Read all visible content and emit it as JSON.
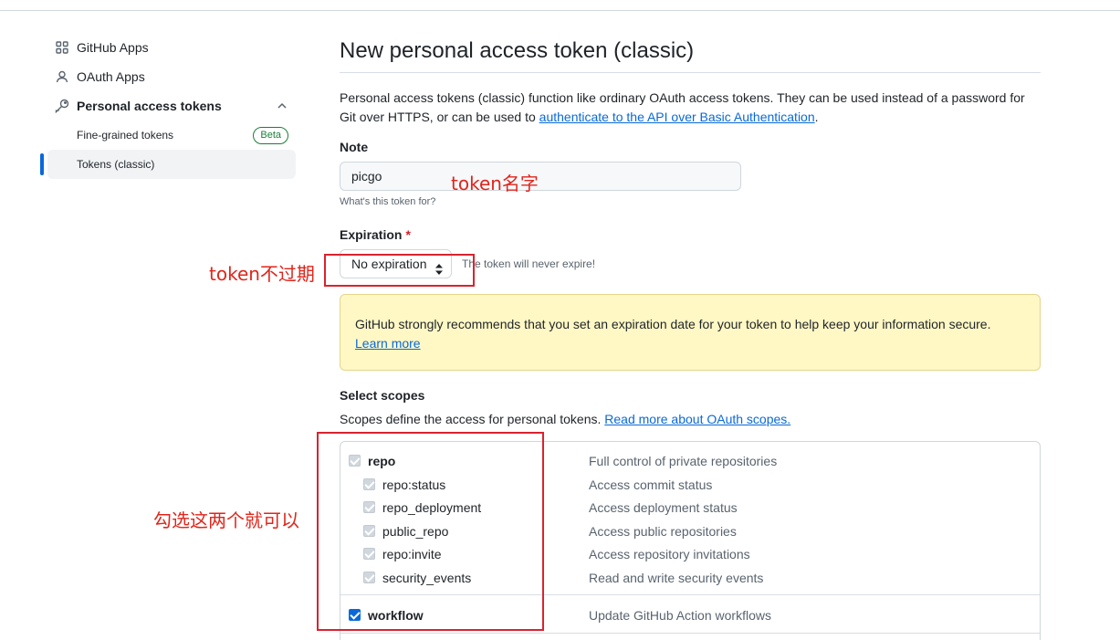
{
  "sidebar": {
    "items": [
      {
        "label": "GitHub Apps",
        "icon": "apps-grid-icon"
      },
      {
        "label": "OAuth Apps",
        "icon": "person-icon"
      },
      {
        "label": "Personal access tokens",
        "icon": "key-icon"
      }
    ],
    "sub_items": [
      {
        "label": "Fine-grained tokens",
        "badge": "Beta"
      },
      {
        "label": "Tokens (classic)",
        "active": true
      }
    ]
  },
  "main": {
    "title": "New personal access token (classic)",
    "description_prefix": "Personal access tokens (classic) function like ordinary OAuth access tokens. They can be used instead of a password for Git over HTTPS, or can be used to ",
    "description_link": "authenticate to the API over Basic Authentication",
    "description_suffix": ".",
    "note": {
      "label": "Note",
      "value": "picgo",
      "hint": "What's this token for?"
    },
    "expiration": {
      "label": "Expiration",
      "required_mark": "*",
      "selected": "No expiration",
      "note": "The token will never expire!"
    },
    "flash": {
      "text": "GitHub strongly recommends that you set an expiration date for your token to help keep your information secure.",
      "link": "Learn more"
    },
    "scopes": {
      "label": "Select scopes",
      "desc_prefix": "Scopes define the access for personal tokens. ",
      "desc_link": "Read more about OAuth scopes.",
      "items": [
        {
          "name": "repo",
          "desc": "Full control of private repositories",
          "checked": true,
          "level": 0
        },
        {
          "name": "repo:status",
          "desc": "Access commit status",
          "checked": true,
          "level": 1
        },
        {
          "name": "repo_deployment",
          "desc": "Access deployment status",
          "checked": true,
          "level": 1
        },
        {
          "name": "public_repo",
          "desc": "Access public repositories",
          "checked": true,
          "level": 1
        },
        {
          "name": "repo:invite",
          "desc": "Access repository invitations",
          "checked": true,
          "level": 1
        },
        {
          "name": "security_events",
          "desc": "Read and write security events",
          "checked": true,
          "level": 1
        },
        {
          "name": "workflow",
          "desc": "Update GitHub Action workflows",
          "checked": true,
          "level": 0
        }
      ]
    }
  },
  "annotations": {
    "token_name": "token名字",
    "no_expire": "token不过期",
    "check_these": "勾选这两个就可以"
  },
  "colors": {
    "accent": "#0969da",
    "annotation": "#e0251b",
    "flash_bg": "#fff8c5"
  }
}
